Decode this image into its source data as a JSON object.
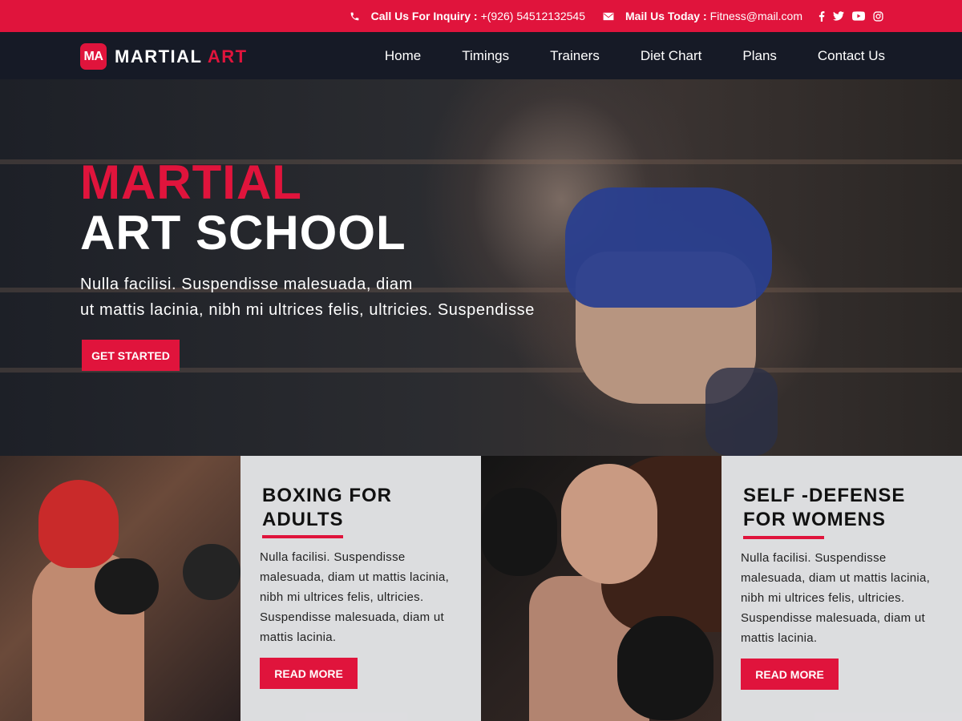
{
  "topbar": {
    "call_label": "Call Us For Inquiry :",
    "call_value": "+(926) 54512132545",
    "mail_label": "Mail Us Today :",
    "mail_value": "Fitness@mail.com",
    "social_icons": [
      "facebook-icon",
      "twitter-icon",
      "youtube-icon",
      "instagram-icon"
    ]
  },
  "nav": {
    "logo_badge": "MA",
    "logo_word1": "MARTIAL",
    "logo_word2": "ART",
    "items": [
      "Home",
      "Timings",
      "Trainers",
      "Diet Chart",
      "Plans",
      "Contact Us"
    ]
  },
  "hero": {
    "title_line1": "MARTIAL",
    "title_line2": "ART SCHOOL",
    "desc_line1": "Nulla facilisi. Suspendisse malesuada, diam",
    "desc_line2": "ut mattis lacinia, nibh mi ultrices felis, ultricies. Suspendisse",
    "button": "GET STARTED"
  },
  "cards": [
    {
      "title": "BOXING FOR ADULTS",
      "text": "Nulla facilisi. Suspendisse malesuada, diam ut mattis lacinia, nibh mi ultrices felis, ultricies. Suspendisse malesuada, diam ut mattis lacinia.",
      "button": "READ MORE"
    },
    {
      "title": "SELF -DEFENSE FOR WOMENS",
      "text": "Nulla facilisi. Suspendisse malesuada, diam ut mattis lacinia, nibh mi ultrices felis, ultricies. Suspendisse malesuada, diam ut mattis lacinia.",
      "button": "READ MORE"
    }
  ],
  "colors": {
    "accent": "#e0143c",
    "nav_bg": "#161a26",
    "card_bg": "#ececee"
  }
}
